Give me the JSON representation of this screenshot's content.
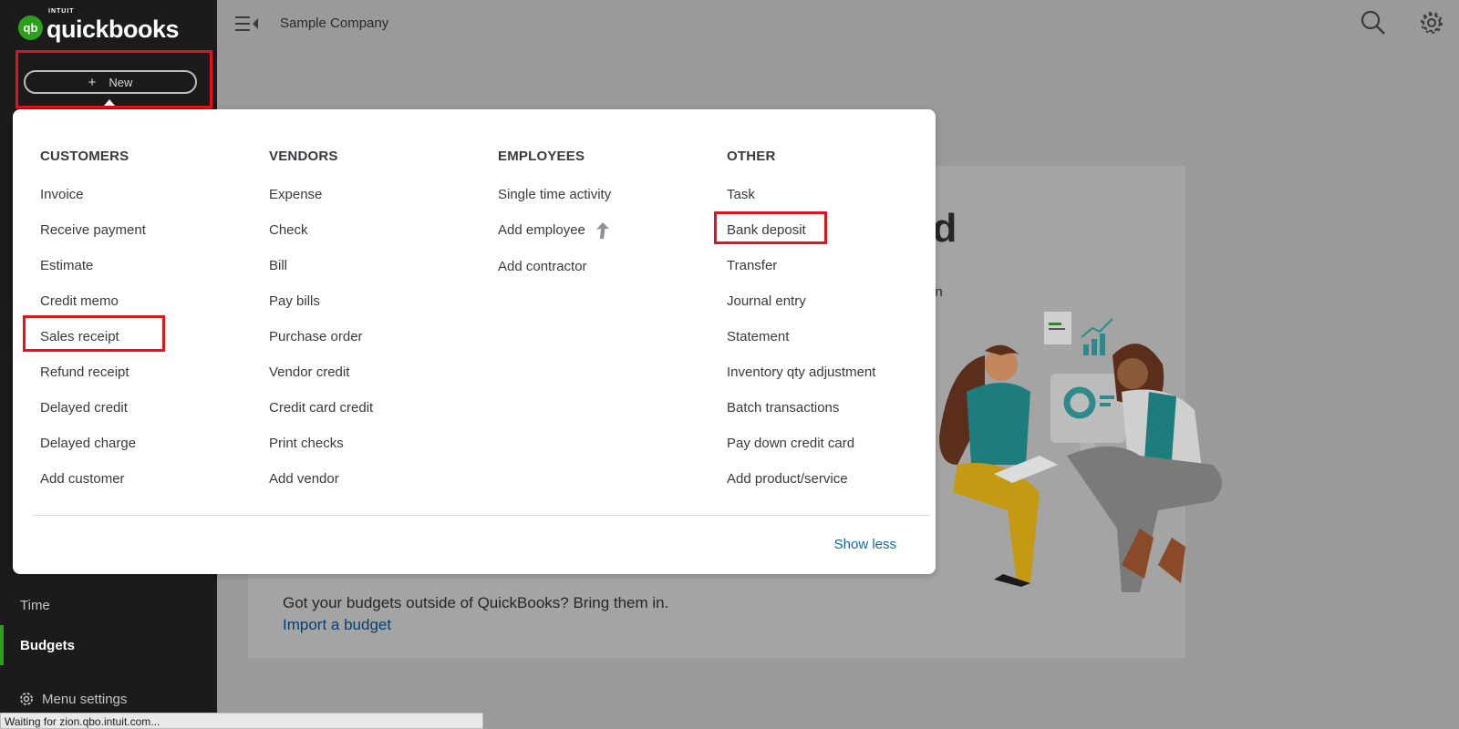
{
  "brand": {
    "logo_mark": "qb",
    "intuit": "INTUIT",
    "name": "quickbooks"
  },
  "new_button": {
    "label": "New",
    "plus": "+"
  },
  "header": {
    "company": "Sample Company",
    "icons": [
      "menu-collapse-icon",
      "search-icon",
      "gear-icon"
    ]
  },
  "sidebar": {
    "items": [
      {
        "label": "Time",
        "active": false
      },
      {
        "label": "Budgets",
        "active": true
      }
    ],
    "menu_settings": "Menu settings"
  },
  "background": {
    "title_fragment": "ad",
    "sub_fragment": "run",
    "budget_text": "Got your budgets outside of QuickBooks? Bring them in.",
    "import_link": "Import a budget"
  },
  "new_menu": {
    "columns": [
      {
        "heading": "CUSTOMERS",
        "items": [
          "Invoice",
          "Receive payment",
          "Estimate",
          "Credit memo",
          "Sales receipt",
          "Refund receipt",
          "Delayed credit",
          "Delayed charge",
          "Add customer"
        ]
      },
      {
        "heading": "VENDORS",
        "items": [
          "Expense",
          "Check",
          "Bill",
          "Pay bills",
          "Purchase order",
          "Vendor credit",
          "Credit card credit",
          "Print checks",
          "Add vendor"
        ]
      },
      {
        "heading": "EMPLOYEES",
        "items": [
          "Single time activity",
          "Add employee",
          "Add contractor"
        ]
      },
      {
        "heading": "OTHER",
        "items": [
          "Task",
          "Bank deposit",
          "Transfer",
          "Journal entry",
          "Statement",
          "Inventory qty adjustment",
          "Batch transactions",
          "Pay down credit card",
          "Add product/service"
        ]
      }
    ],
    "show_less": "Show less"
  },
  "status_bar": "Waiting for zion.qbo.intuit.com...",
  "colors": {
    "sidebar_bg": "#1b1b1b",
    "brand_green": "#2ca01c",
    "highlight_red": "#e8101a",
    "link_blue": "#0d69a6"
  }
}
